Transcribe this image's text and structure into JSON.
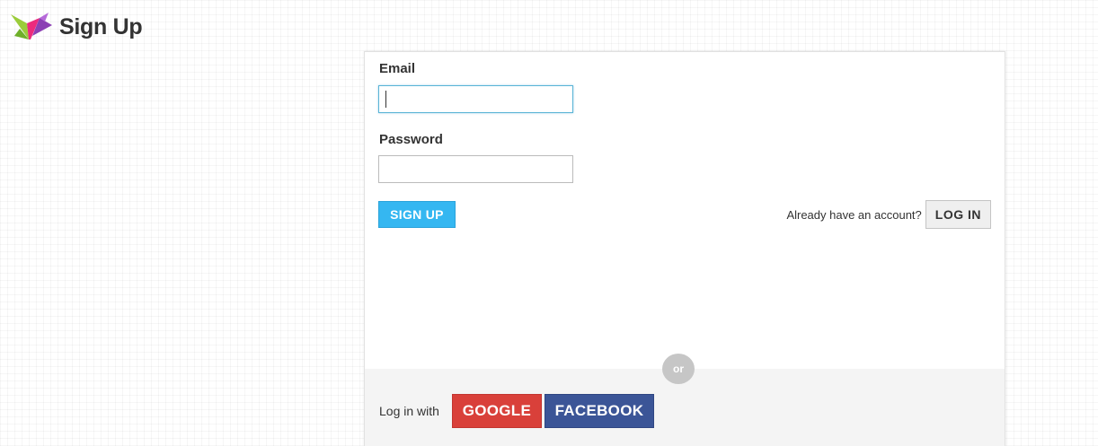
{
  "header": {
    "title": "Sign Up",
    "logo_icon": "crane-logo-icon"
  },
  "form": {
    "email_label": "Email",
    "email_value": "",
    "password_label": "Password",
    "password_value": "",
    "signup_label": "SIGN UP",
    "account_prompt": "Already have an account?",
    "login_label": "LOG IN"
  },
  "social": {
    "divider_text": "or",
    "prompt": "Log in with",
    "google_label": "GOOGLE",
    "facebook_label": "FACEBOOK"
  },
  "colors": {
    "signup_button": "#35b7f1",
    "google_button": "#d9403a",
    "facebook_button": "#3b5597",
    "input_focus_border": "#5ab4d6"
  }
}
